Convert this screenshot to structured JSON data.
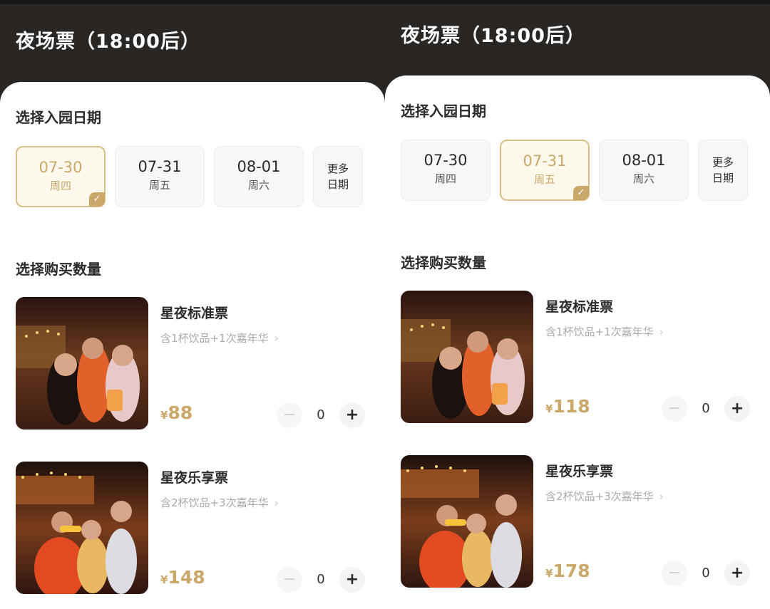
{
  "screens": [
    {
      "title": "夜场票（18:00后）",
      "date_section_label": "选择入园日期",
      "dates": [
        {
          "date": "07-30",
          "weekday": "周四",
          "selected": true
        },
        {
          "date": "07-31",
          "weekday": "周五",
          "selected": false
        },
        {
          "date": "08-01",
          "weekday": "周六",
          "selected": false
        }
      ],
      "more_dates_line1": "更多",
      "more_dates_line2": "日期",
      "quantity_section_label": "选择购买数量",
      "tickets": [
        {
          "name": "星夜标准票",
          "desc": "含1杯饮品+1次嘉年华",
          "currency": "¥",
          "price": "88",
          "quantity": "0"
        },
        {
          "name": "星夜乐享票",
          "desc": "含2杯饮品+3次嘉年华",
          "currency": "¥",
          "price": "148",
          "quantity": "0"
        }
      ]
    },
    {
      "title": "夜场票（18:00后）",
      "date_section_label": "选择入园日期",
      "dates": [
        {
          "date": "07-30",
          "weekday": "周四",
          "selected": false
        },
        {
          "date": "07-31",
          "weekday": "周五",
          "selected": true
        },
        {
          "date": "08-01",
          "weekday": "周六",
          "selected": false
        }
      ],
      "more_dates_line1": "更多",
      "more_dates_line2": "日期",
      "quantity_section_label": "选择购买数量",
      "tickets": [
        {
          "name": "星夜标准票",
          "desc": "含1杯饮品+1次嘉年华",
          "currency": "¥",
          "price": "118",
          "quantity": "0"
        },
        {
          "name": "星夜乐享票",
          "desc": "含2杯饮品+3次嘉年华",
          "currency": "¥",
          "price": "178",
          "quantity": "0"
        }
      ]
    }
  ],
  "icons": {
    "chevron": "›",
    "check": "✓",
    "minus": "−",
    "plus": "+"
  },
  "colors": {
    "header_bg": "#2a2623",
    "accent_gold": "#c9a86a",
    "selected_bg": "#fdf8ec"
  }
}
